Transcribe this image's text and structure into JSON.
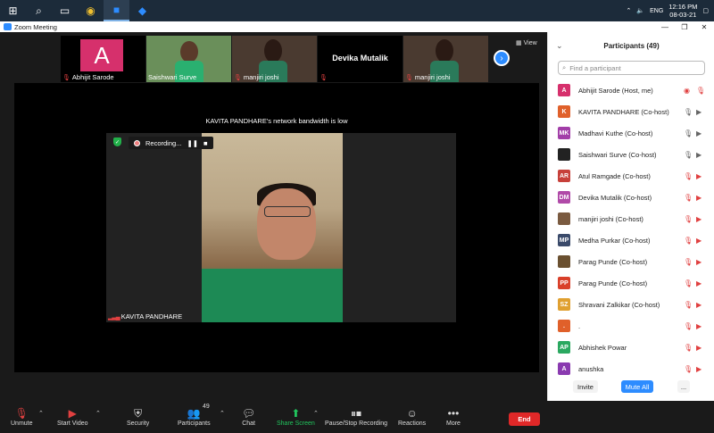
{
  "taskbar": {
    "language": "ENG",
    "time": "12:16 PM",
    "date": "08-03-21"
  },
  "window": {
    "title": "Zoom Meeting"
  },
  "thumbnails": [
    {
      "name": "Abhijit Sarode",
      "initial": "A",
      "muted": true
    },
    {
      "name": "Saishwari Surve",
      "muted": false
    },
    {
      "name": "manjiri joshi",
      "muted": true
    },
    {
      "name": "Devika Mutalik",
      "label": "Devika Mutalik",
      "muted": true
    },
    {
      "name": "manjiri joshi",
      "muted": true
    }
  ],
  "view_label": "View",
  "main_video": {
    "bandwidth_message": "KAVITA PANDHARE's network bandwidth is low",
    "recording_label": "Recording...",
    "speaker_name": "KAVITA PANDHARE"
  },
  "toolbar": {
    "unmute": "Unmute",
    "start_video": "Start Video",
    "security": "Security",
    "participants": "Participants",
    "participants_count": "49",
    "chat": "Chat",
    "share_screen": "Share Screen",
    "pause_recording": "Pause/Stop Recording",
    "reactions": "Reactions",
    "more": "More",
    "end": "End"
  },
  "panel": {
    "title": "Participants (49)",
    "search_placeholder": "Find a participant",
    "participants": [
      {
        "initials": "A",
        "name": "Abhijit Sarode (Host, me)",
        "color": "#d6306c",
        "icon1": "rec",
        "icon2": "mic-off"
      },
      {
        "initials": "K",
        "name": "KAVITA PANDHARE (Co-host)",
        "color": "#e0602a",
        "icon1": "mic",
        "icon2": "cam"
      },
      {
        "initials": "MK",
        "name": "Madhavi Kuthe (Co-host)",
        "color": "#a23ea8",
        "icon1": "mic",
        "icon2": "cam"
      },
      {
        "initials": "",
        "name": "Saishwari Surve (Co-host)",
        "color": "#222222",
        "icon1": "mic",
        "icon2": "cam"
      },
      {
        "initials": "AR",
        "name": "Atul Ramgade (Co-host)",
        "color": "#c7403a",
        "icon1": "mic-off",
        "icon2": "cam-off"
      },
      {
        "initials": "DM",
        "name": "Devika Mutalik (Co-host)",
        "color": "#b04aa8",
        "icon1": "mic-off",
        "icon2": "cam-off"
      },
      {
        "initials": "",
        "name": "manjiri joshi (Co-host)",
        "color": "#7a5a40",
        "icon1": "mic-off",
        "icon2": "cam-off"
      },
      {
        "initials": "MP",
        "name": "Medha Purkar (Co-host)",
        "color": "#3a4a6a",
        "icon1": "mic-off",
        "icon2": "cam-off"
      },
      {
        "initials": "",
        "name": "Parag Punde (Co-host)",
        "color": "#6a5030",
        "icon1": "mic-off",
        "icon2": "cam-off"
      },
      {
        "initials": "PP",
        "name": "Parag Punde (Co-host)",
        "color": "#d9402a",
        "icon1": "mic-off",
        "icon2": "cam-off"
      },
      {
        "initials": "SZ",
        "name": "Shravani Zalkikar (Co-host)",
        "color": "#e0a030",
        "icon1": "mic-off",
        "icon2": "cam-off"
      },
      {
        "initials": ".",
        "name": ".",
        "color": "#e0602a",
        "icon1": "mic-off",
        "icon2": "cam-off"
      },
      {
        "initials": "AP",
        "name": "Abhishek Powar",
        "color": "#2aa860",
        "icon1": "mic-off",
        "icon2": "cam-off"
      },
      {
        "initials": "A",
        "name": "anushka",
        "color": "#8a3ab0",
        "icon1": "mic-off",
        "icon2": "cam-off"
      }
    ],
    "invite": "Invite",
    "mute_all": "Mute All",
    "more": "..."
  }
}
